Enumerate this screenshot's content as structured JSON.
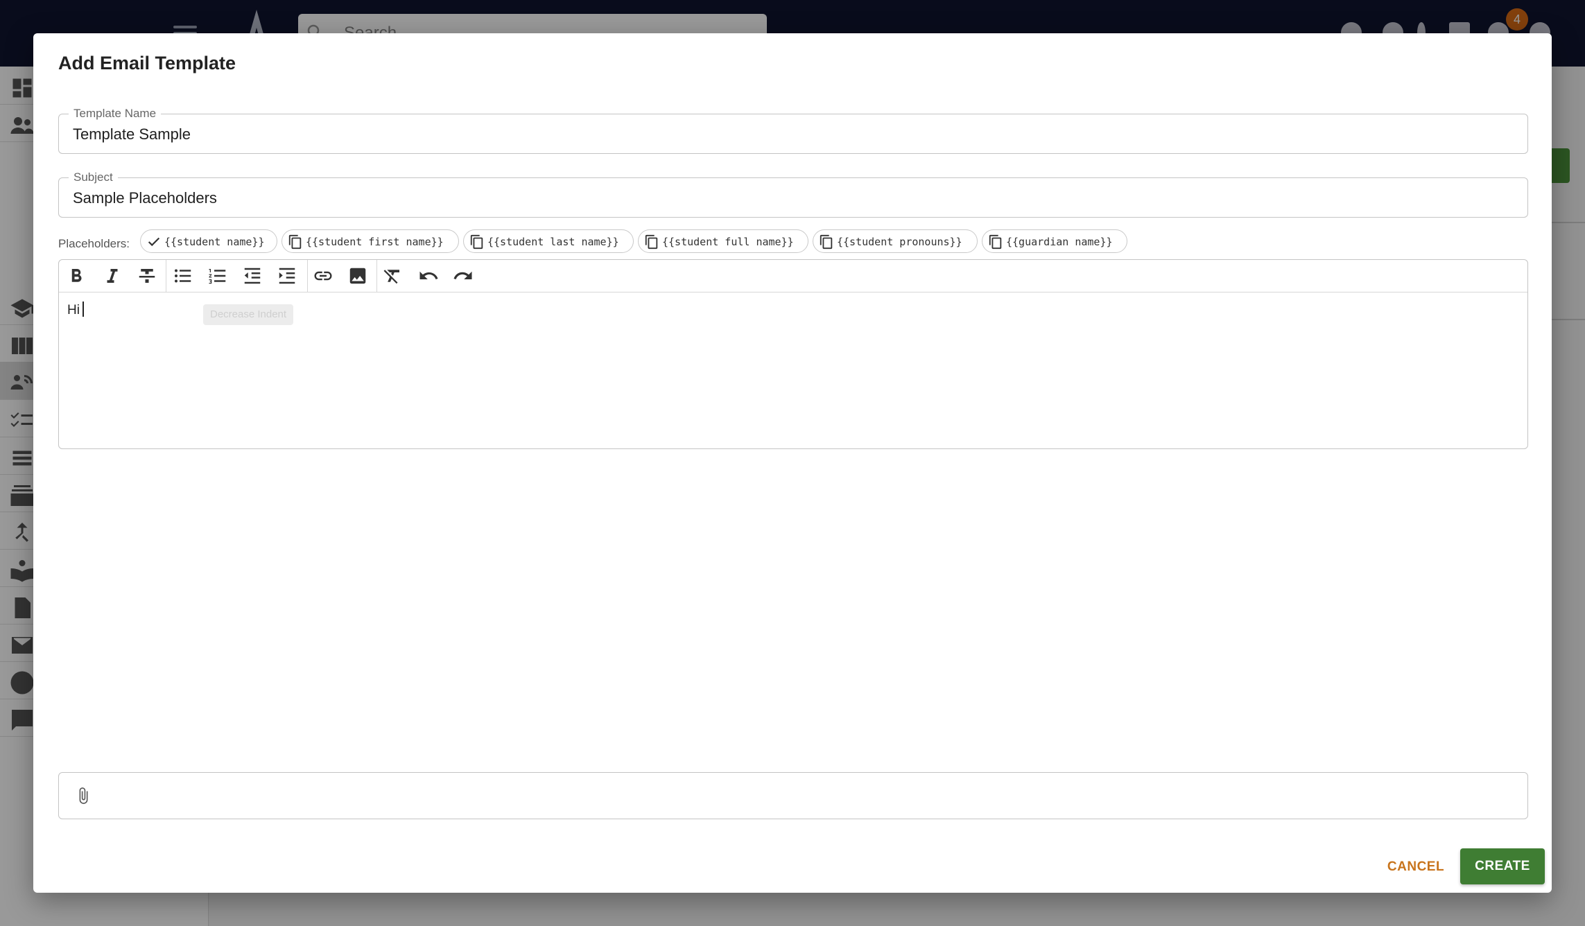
{
  "app": {
    "search_placeholder": "Search",
    "notification_count": "4"
  },
  "dialog": {
    "title": "Add Email Template",
    "template_name": {
      "label": "Template Name",
      "value": "Template Sample"
    },
    "subject": {
      "label": "Subject",
      "value": "Sample Placeholders"
    },
    "placeholders_label": "Placeholders:",
    "placeholders": [
      {
        "text": "{{student name}}",
        "icon": "check-icon"
      },
      {
        "text": "{{student first name}}",
        "icon": "copy-icon"
      },
      {
        "text": "{{student last name}}",
        "icon": "copy-icon"
      },
      {
        "text": "{{student full name}}",
        "icon": "copy-icon"
      },
      {
        "text": "{{student pronouns}}",
        "icon": "copy-icon"
      },
      {
        "text": "{{guardian name}}",
        "icon": "copy-icon"
      }
    ],
    "editor": {
      "body_text": "Hi",
      "tooltip": "Decrease Indent",
      "toolbar": [
        "bold-icon",
        "italic-icon",
        "strikethrough-icon",
        "bullet-list-icon",
        "numbered-list-icon",
        "decrease-indent-icon",
        "increase-indent-icon",
        "link-icon",
        "image-icon",
        "clear-format-icon",
        "undo-icon",
        "redo-icon"
      ]
    },
    "attachment_icon": "paperclip-icon",
    "cancel_label": "CANCEL",
    "create_label": "CREATE"
  },
  "colors": {
    "topbar": "#0f1430",
    "create_button": "#3f7d33",
    "cancel_text": "#c8741c",
    "badge": "#d96b15"
  }
}
